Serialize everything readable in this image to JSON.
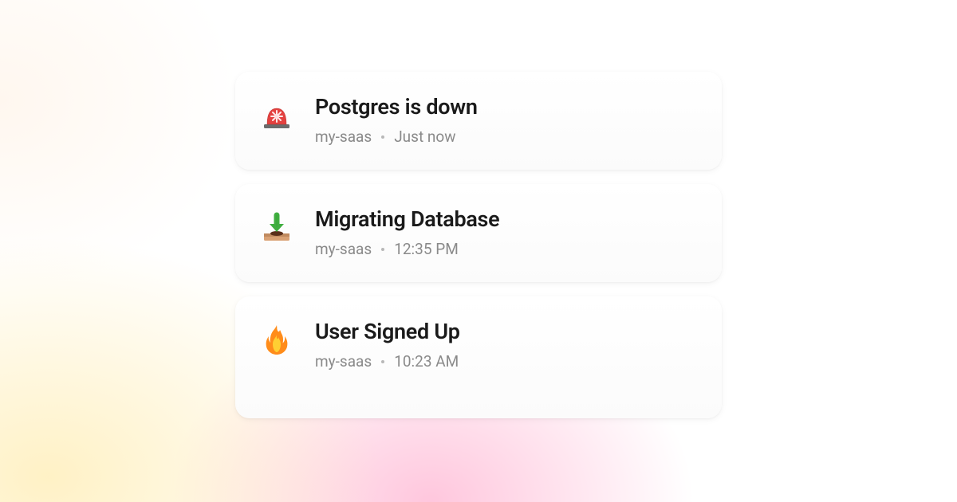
{
  "notifications": [
    {
      "icon": "siren-icon",
      "title": "Postgres is down",
      "source": "my-saas",
      "time": "Just now"
    },
    {
      "icon": "download-tray-icon",
      "title": "Migrating Database",
      "source": "my-saas",
      "time": "12:35 PM"
    },
    {
      "icon": "fire-icon",
      "title": "User Signed Up",
      "source": "my-saas",
      "time": "10:23 AM"
    }
  ]
}
